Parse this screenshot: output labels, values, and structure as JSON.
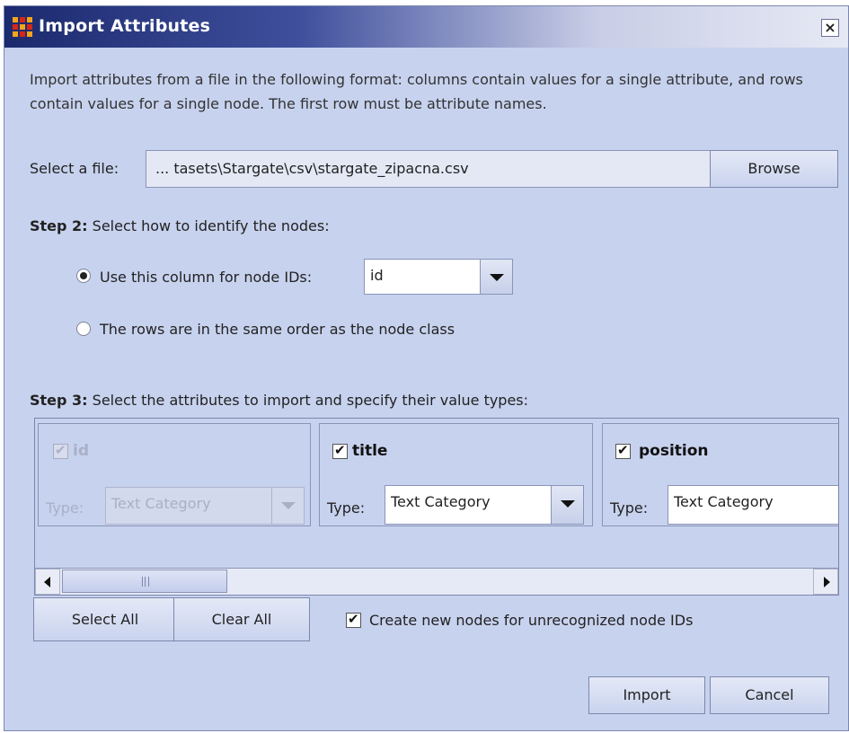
{
  "window": {
    "title": "Import Attributes",
    "close_label": "×"
  },
  "description": "Import attributes from a file in the following format: columns contain values for a single attribute, and rows contain values for a single node. The first row must be attribute names.",
  "file_select": {
    "label": "Select a file:",
    "value": "... tasets\\Stargate\\csv\\stargate_zipacna.csv",
    "browse_label": "Browse"
  },
  "step2": {
    "heading_bold": "Step 2:",
    "heading_rest": "Select how to identify the nodes:",
    "options": [
      {
        "label": "Use this column for node IDs:",
        "selected": true
      },
      {
        "label": "The rows are in the same order as the node class",
        "selected": false
      }
    ],
    "node_id_column": "id"
  },
  "step3": {
    "heading_bold": "Step 3:",
    "heading_rest": "Select the attributes to import and specify their value types:",
    "type_label": "Type:",
    "attributes": [
      {
        "name": "id",
        "checked": true,
        "enabled": false,
        "type": "Text Category"
      },
      {
        "name": "title",
        "checked": true,
        "enabled": true,
        "type": "Text Category"
      },
      {
        "name": "position",
        "checked": true,
        "enabled": true,
        "type": "Text Category"
      }
    ]
  },
  "buttons": {
    "select_all": "Select All",
    "clear_all": "Clear All",
    "import": "Import",
    "cancel": "Cancel"
  },
  "create_new_nodes": {
    "label": "Create new nodes for unrecognized node IDs",
    "checked": true
  },
  "colors": {
    "dialog_bg": "#c7d2ee",
    "title_gradient_start": "#1b2a6e",
    "title_gradient_end": "#e6e9f4",
    "app_icon_yellow": "#f2a51a",
    "app_icon_red": "#d82518"
  }
}
